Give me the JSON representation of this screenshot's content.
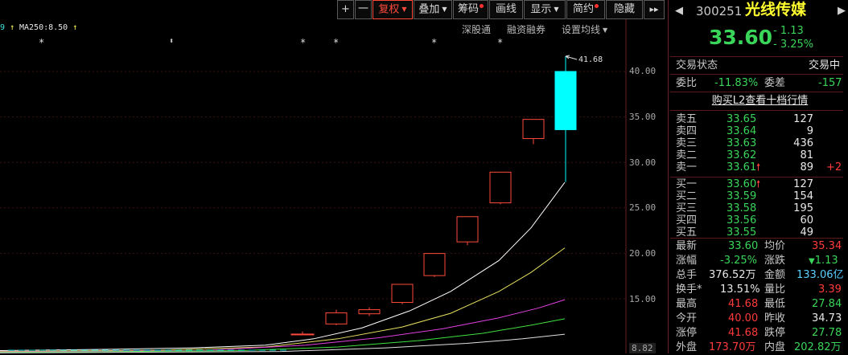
{
  "toolbar": {
    "plus": "+",
    "minus": "一",
    "fuquan": "复权",
    "diejia": "叠加",
    "chouma": "筹码",
    "huaxian": "画线",
    "xianshi": "显示",
    "jianyue": "简约",
    "yincang": "隐藏",
    "more": "▸▸"
  },
  "indicator": {
    "ma_prefix": "9",
    "ma250_label": "MA250:8.50"
  },
  "sublinks": {
    "shengutong": "深股通",
    "rongzi": "融资融券",
    "junxian": "设置均线"
  },
  "chart_markers": {
    "star": "*",
    "diamond": "⬍"
  },
  "price_axis": {
    "labels": [
      "40.00",
      "35.00",
      "30.00",
      "25.00",
      "20.00",
      "15.00",
      "8.82"
    ]
  },
  "chart_data": {
    "type": "candlestick",
    "ylim": [
      9.0,
      42.0
    ],
    "high_annotation": "41.68",
    "candles": [
      {
        "open": 11.12,
        "close": 11.12,
        "high": 11.4,
        "low": 11.12
      },
      {
        "open": 12.23,
        "close": 13.45,
        "high": 13.8,
        "low": 12.1
      },
      {
        "open": 13.35,
        "close": 13.8,
        "high": 14.05,
        "low": 13.1
      },
      {
        "open": 14.6,
        "close": 16.59,
        "high": 16.59,
        "low": 14.4
      },
      {
        "open": 17.55,
        "close": 19.98,
        "high": 19.98,
        "low": 17.4
      },
      {
        "open": 21.26,
        "close": 24.03,
        "high": 24.03,
        "low": 20.9
      },
      {
        "open": 25.55,
        "close": 28.93,
        "high": 28.93,
        "low": 25.4
      },
      {
        "open": 32.62,
        "close": 34.73,
        "high": 34.73,
        "low": 32.0
      },
      {
        "open": 40.0,
        "close": 33.6,
        "high": 41.68,
        "low": 27.84
      }
    ],
    "ma_lines": [
      {
        "color": "#ffffff",
        "points": [
          [
            0,
            9.3
          ],
          [
            140,
            9.45
          ],
          [
            240,
            9.6
          ],
          [
            330,
            9.9
          ],
          [
            390,
            10.6
          ],
          [
            450,
            11.8
          ],
          [
            510,
            13.7
          ],
          [
            560,
            15.8
          ],
          [
            620,
            19.2
          ],
          [
            660,
            22.8
          ],
          [
            702,
            27.8
          ]
        ]
      },
      {
        "color": "#e8e060",
        "points": [
          [
            0,
            9.2
          ],
          [
            200,
            9.35
          ],
          [
            330,
            9.7
          ],
          [
            420,
            10.6
          ],
          [
            500,
            11.9
          ],
          [
            560,
            13.4
          ],
          [
            620,
            15.8
          ],
          [
            660,
            17.9
          ],
          [
            702,
            20.6
          ]
        ]
      },
      {
        "color": "#e040e0",
        "points": [
          [
            0,
            9.15
          ],
          [
            250,
            9.3
          ],
          [
            380,
            9.9
          ],
          [
            470,
            10.7
          ],
          [
            550,
            11.7
          ],
          [
            620,
            12.9
          ],
          [
            670,
            14.0
          ],
          [
            702,
            14.9
          ]
        ]
      },
      {
        "color": "#40e040",
        "points": [
          [
            0,
            9.1
          ],
          [
            300,
            9.3
          ],
          [
            420,
            9.7
          ],
          [
            520,
            10.4
          ],
          [
            600,
            11.2
          ],
          [
            660,
            12.1
          ],
          [
            702,
            12.8
          ]
        ]
      },
      {
        "color": "#e0e0e0",
        "points": [
          [
            0,
            9.05
          ],
          [
            350,
            9.2
          ],
          [
            480,
            9.6
          ],
          [
            580,
            10.1
          ],
          [
            650,
            10.6
          ],
          [
            702,
            11.1
          ]
        ]
      }
    ]
  },
  "stock": {
    "code": "300251",
    "name": "光线传媒",
    "price": "33.60",
    "change": "- 1.13",
    "change_pct": "- 3.25%"
  },
  "status": {
    "label": "交易状态",
    "value": "交易中"
  },
  "weibi": {
    "label": "委比",
    "value": "-11.83%",
    "diff_label": "委差",
    "diff_value": "-157"
  },
  "l2_link": "购买L2查看十档行情",
  "orderbook": {
    "sell": [
      {
        "label": "卖五",
        "price": "33.65",
        "vol": "127",
        "chg": "",
        "arrow": ""
      },
      {
        "label": "卖四",
        "price": "33.64",
        "vol": "9",
        "chg": "",
        "arrow": ""
      },
      {
        "label": "卖三",
        "price": "33.63",
        "vol": "436",
        "chg": "",
        "arrow": ""
      },
      {
        "label": "卖二",
        "price": "33.62",
        "vol": "81",
        "chg": "",
        "arrow": ""
      },
      {
        "label": "卖一",
        "price": "33.61",
        "vol": "89",
        "chg": "+2",
        "arrow": "🠕"
      }
    ],
    "buy": [
      {
        "label": "买一",
        "price": "33.60",
        "vol": "127",
        "chg": "",
        "arrow": "🠕"
      },
      {
        "label": "买二",
        "price": "33.59",
        "vol": "154",
        "chg": "",
        "arrow": ""
      },
      {
        "label": "买三",
        "price": "33.58",
        "vol": "195",
        "chg": "",
        "arrow": ""
      },
      {
        "label": "买四",
        "price": "33.56",
        "vol": "60",
        "chg": "",
        "arrow": ""
      },
      {
        "label": "买五",
        "price": "33.55",
        "vol": "49",
        "chg": "",
        "arrow": ""
      }
    ]
  },
  "quote": {
    "zuixin_label": "最新",
    "zuixin": "33.60",
    "junjia_label": "均价",
    "junjia": "35.34",
    "zhangfu_label": "涨幅",
    "zhangfu": "-3.25%",
    "zhangdie_label": "涨跌",
    "zhangdie": "1.13",
    "zongshou_label": "总手",
    "zongshou": "376.52万",
    "jine_label": "金额",
    "jine": "133.06亿",
    "huanshou_label": "换手*",
    "huanshou": "13.51%",
    "liangbi_label": "量比",
    "liangbi": "3.39",
    "zuigao_label": "最高",
    "zuigao": "41.68",
    "zuidi_label": "最低",
    "zuidi": "27.84",
    "jinkai_label": "今开",
    "jinkai": "40.00",
    "zuoshou_label": "昨收",
    "zuoshou": "34.73",
    "zhangting_label": "涨停",
    "zhangting": "41.68",
    "dieting_label": "跌停",
    "dieting": "27.78",
    "waipan_label": "外盘",
    "waipan": "173.70万",
    "neipan_label": "内盘",
    "neipan": "202.82万"
  },
  "colors": {
    "up": "#ff3b3b",
    "down": "#39d65a",
    "cyan": "#00ffff"
  }
}
